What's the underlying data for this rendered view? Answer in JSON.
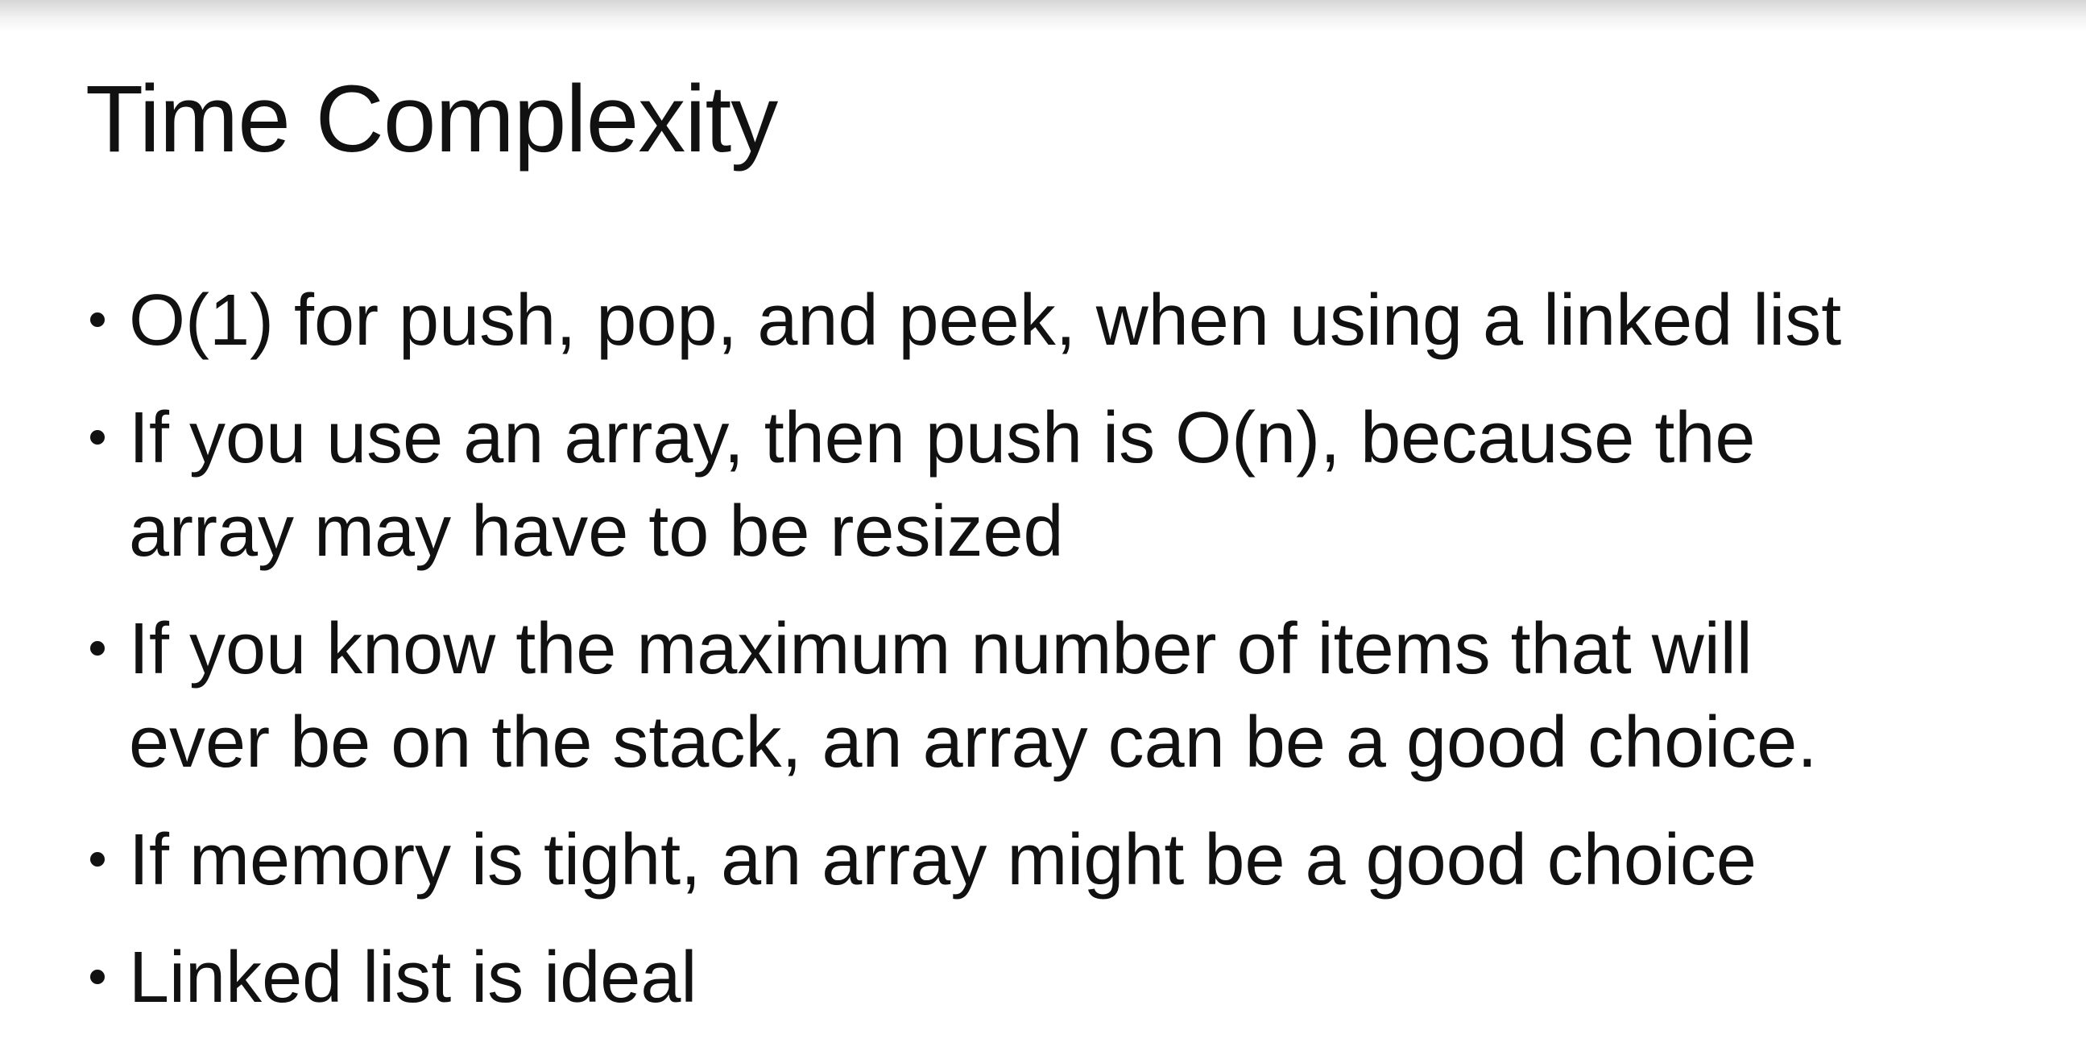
{
  "slide": {
    "title": "Time Complexity",
    "bullets": [
      {
        "lines": [
          "O(1) for push, pop, and peek, when using a linked list"
        ]
      },
      {
        "lines": [
          "If you use an array, then push is O(n), because the",
          "array may have to be resized"
        ]
      },
      {
        "lines": [
          "If you know the maximum number of items that will",
          "ever be on the stack, an array can be a good choice."
        ]
      },
      {
        "lines": [
          "If memory is tight, an array might be a good choice"
        ]
      },
      {
        "lines": [
          "Linked list is ideal"
        ]
      }
    ]
  }
}
